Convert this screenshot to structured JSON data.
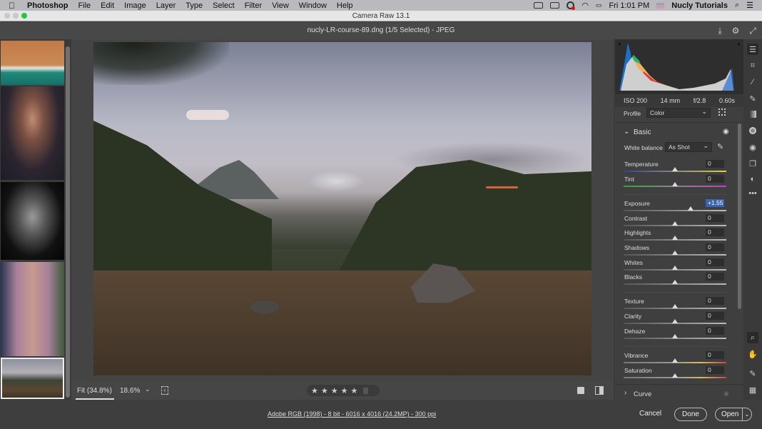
{
  "menubar": {
    "app_name": "Photoshop",
    "items": [
      "File",
      "Edit",
      "Image",
      "Layer",
      "Type",
      "Select",
      "Filter",
      "View",
      "Window",
      "Help"
    ],
    "clock": "Fri 1:01 PM",
    "user": "Nucly Tutorials"
  },
  "window": {
    "title": "Camera Raw 13.1",
    "document": "nucly-LR-course-89.dng (1/5 Selected)  -  JPEG"
  },
  "filmstrip": {
    "thumbnails": [
      "aerial-beach",
      "woman-veil",
      "woman-bw",
      "building-arch",
      "mountain-landscape"
    ],
    "selected_index": 4
  },
  "viewbar": {
    "fit_label": "Fit (34.8%)",
    "zoom_value": "18.6%",
    "rating_stars": 5
  },
  "histogram": {
    "exif": {
      "iso": "ISO 200",
      "focal": "14 mm",
      "aperture": "f/2.8",
      "shutter": "0.60s"
    }
  },
  "profile": {
    "label": "Profile",
    "value": "Color"
  },
  "basic": {
    "title": "Basic",
    "white_balance_label": "White balance",
    "white_balance_value": "As Shot",
    "sliders": [
      {
        "label": "Temperature",
        "value": "0",
        "position": 0.5
      },
      {
        "label": "Tint",
        "value": "0",
        "position": 0.5
      },
      {
        "label": "Exposure",
        "value": "+1.55",
        "position": 0.655
      },
      {
        "label": "Contrast",
        "value": "0",
        "position": 0.5
      },
      {
        "label": "Highlights",
        "value": "0",
        "position": 0.5
      },
      {
        "label": "Shadows",
        "value": "0",
        "position": 0.5
      },
      {
        "label": "Whites",
        "value": "0",
        "position": 0.5
      },
      {
        "label": "Blacks",
        "value": "0",
        "position": 0.5
      },
      {
        "label": "Texture",
        "value": "0",
        "position": 0.5
      },
      {
        "label": "Clarity",
        "value": "0",
        "position": 0.5
      },
      {
        "label": "Dehaze",
        "value": "0",
        "position": 0.5
      },
      {
        "label": "Vibrance",
        "value": "0",
        "position": 0.5
      },
      {
        "label": "Saturation",
        "value": "0",
        "position": 0.5
      }
    ]
  },
  "curve": {
    "title": "Curve"
  },
  "footer": {
    "info": "Adobe RGB (1998) - 8 bit - 6016 x 4016 (24.2MP) - 300 ppi",
    "cancel": "Cancel",
    "done": "Done",
    "open": "Open"
  },
  "colors": {
    "accent": "#3a66b0",
    "selected_value_bg": "#3a66b0"
  }
}
